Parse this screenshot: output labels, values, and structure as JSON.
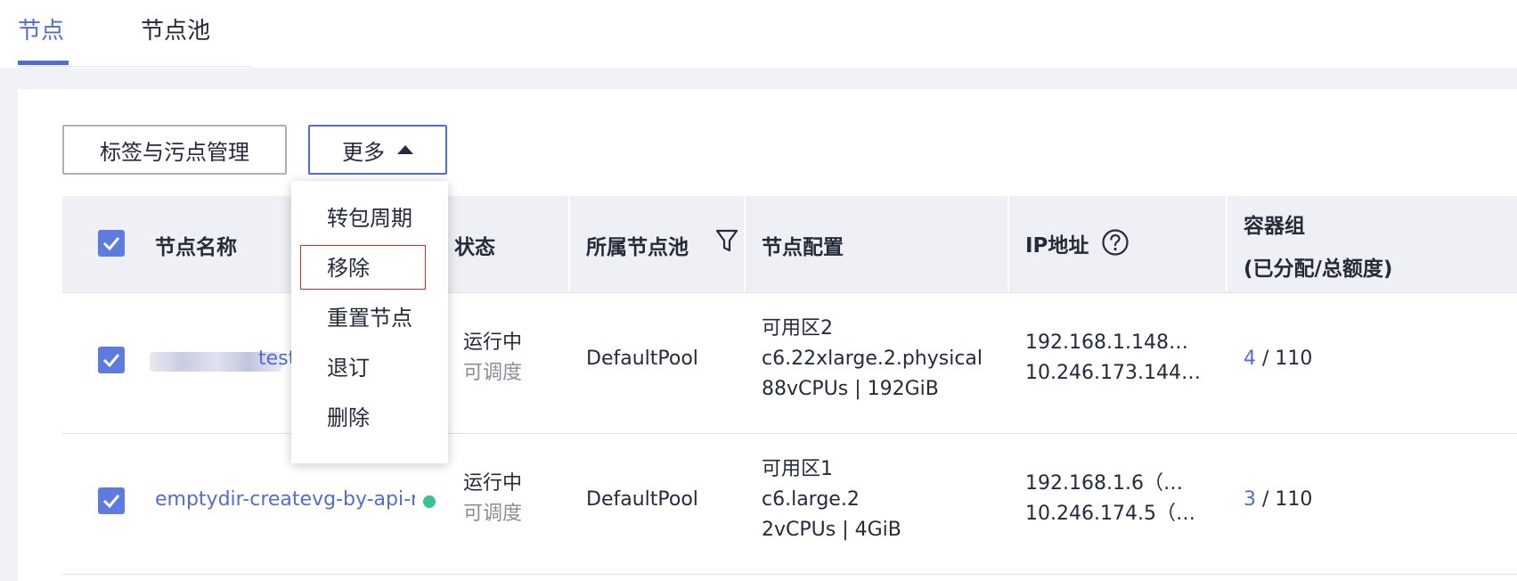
{
  "tabs": [
    {
      "label": "节点",
      "active": true
    },
    {
      "label": "节点池",
      "active": false
    }
  ],
  "toolbar": {
    "tags_button": "标签与污点管理",
    "more_button": "更多"
  },
  "dropdown": {
    "items": [
      "转包周期",
      "移除",
      "重置节点",
      "退订",
      "删除"
    ],
    "highlighted": "移除"
  },
  "table": {
    "headers": {
      "name": "节点名称",
      "status": "状态",
      "pool": "所属节点池",
      "config": "节点配置",
      "ip": "IP地址",
      "pods": "容器组",
      "pods_sub": "(已分配/总额度)"
    },
    "rows": [
      {
        "name": "test-",
        "status": "运行中",
        "schedule": "可调度",
        "pool": "DefaultPool",
        "config": {
          "zone": "可用区2",
          "flavor": "c6.22xlarge.2.physical",
          "spec": "88vCPUs | 192GiB"
        },
        "ip": {
          "primary": "192.168.1.148…",
          "secondary": "10.246.173.144…"
        },
        "pods_allocated": "4",
        "pods_total": "/ 110"
      },
      {
        "name": "emptydir-createvg-by-api-no",
        "status": "运行中",
        "schedule": "可调度",
        "pool": "DefaultPool",
        "config": {
          "zone": "可用区1",
          "flavor": "c6.large.2",
          "spec": "2vCPUs | 4GiB"
        },
        "ip": {
          "primary": "192.168.1.6（…",
          "secondary": "10.246.174.5（…"
        },
        "pods_allocated": "3",
        "pods_total": "/ 110"
      }
    ]
  },
  "colors": {
    "accent": "#526ecc",
    "status_running": "#3ac295",
    "highlight_border": "#e0252f"
  }
}
